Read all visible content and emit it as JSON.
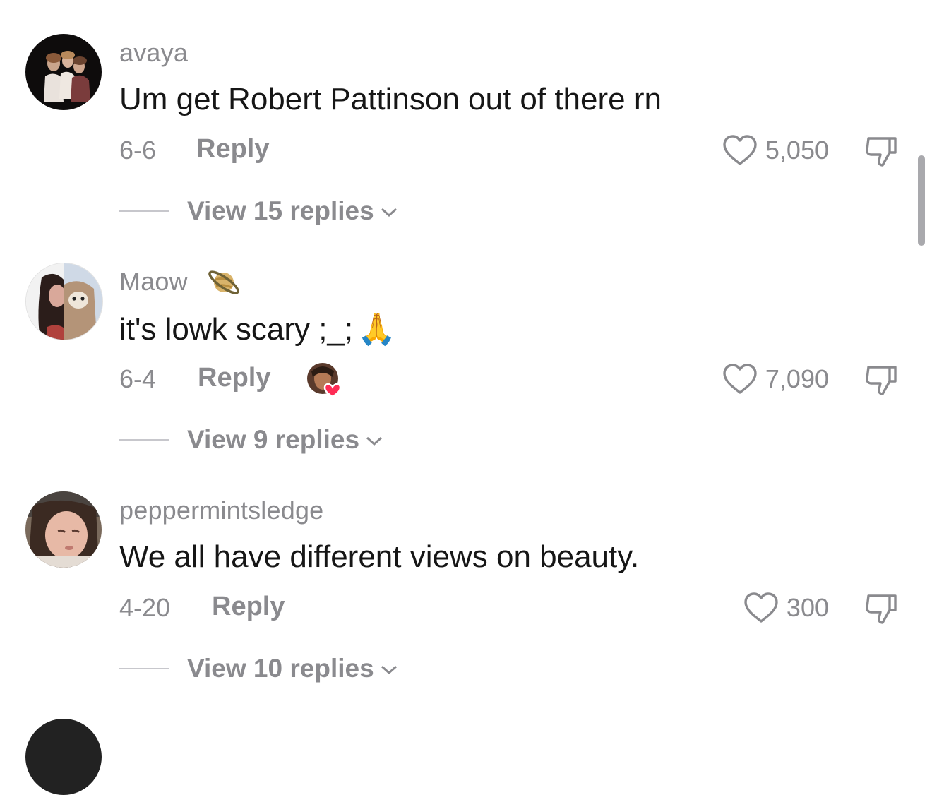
{
  "comments": [
    {
      "username": "avaya",
      "text": "Um get Robert Pattinson out of there rn",
      "date": "6-6",
      "reply_label": "Reply",
      "likes": "5,050",
      "view_replies": "View 15 replies"
    },
    {
      "username": "Maow",
      "badge_icon": "ringed-planet-emoji",
      "text": "it's lowk scary ;_;",
      "text_emoji": "🙏",
      "date": "6-4",
      "reply_label": "Reply",
      "creator_liked": true,
      "likes": "7,090",
      "view_replies": "View 9 replies"
    },
    {
      "username": "peppermintsledge",
      "text": "We all have different views on beauty.",
      "date": "4-20",
      "reply_label": "Reply",
      "likes": "300",
      "view_replies": "View 10 replies"
    }
  ],
  "colors": {
    "muted": "#8a8a8e",
    "text": "#161616",
    "creator_heart": "#fe2c55",
    "scrollbar": "#a9a9ad"
  }
}
